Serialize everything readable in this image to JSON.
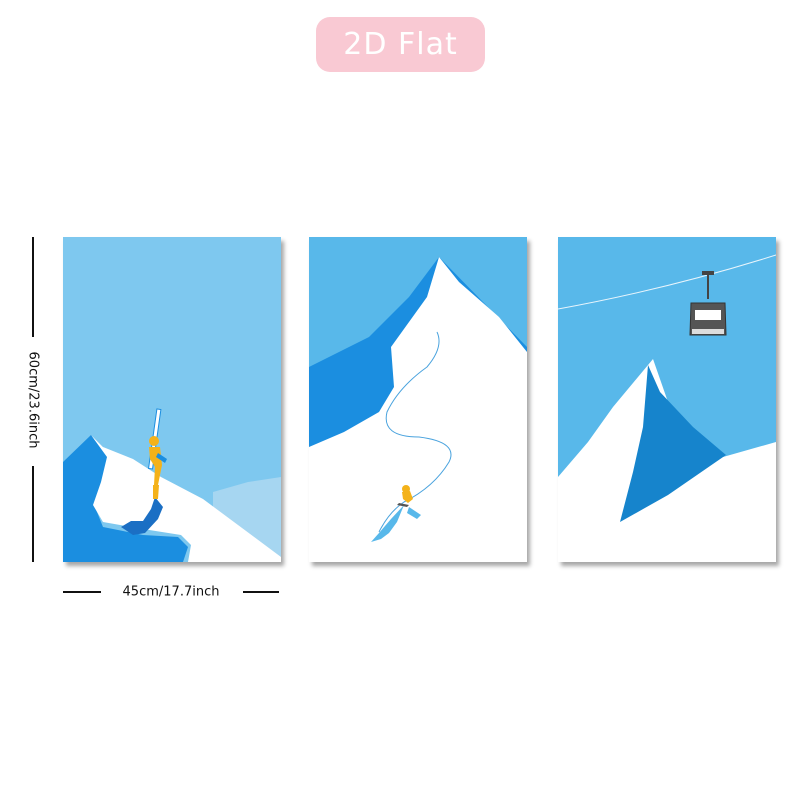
{
  "badge": {
    "label": "2D Flat"
  },
  "dimensions": {
    "height_label": "60cm/23.6inch",
    "width_label": "45cm/17.7inch"
  },
  "colors": {
    "badge_background": "#f9c9d3",
    "sky_light": "#7ec8ef",
    "sky": "#58b8ea",
    "mountain_blue": "#1b8ee0",
    "mountain_shadow": "#1684cc",
    "snow": "#ffffff",
    "skier_yellow": "#f4b21a"
  },
  "panels": [
    {
      "subject": "skier climbing with skis on a snowy ridge"
    },
    {
      "subject": "skier carving down a snowy peak"
    },
    {
      "subject": "cable car gondola above a mountain peak"
    }
  ]
}
